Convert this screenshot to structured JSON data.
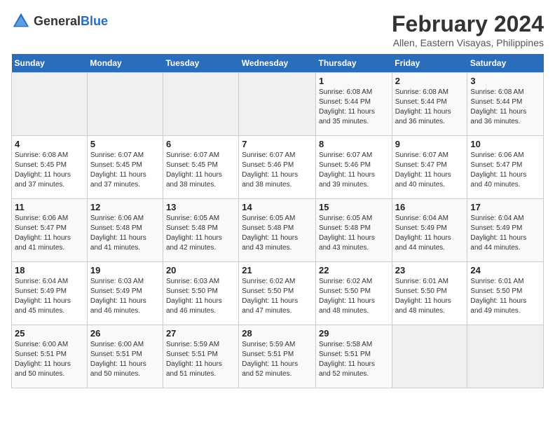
{
  "logo": {
    "text_general": "General",
    "text_blue": "Blue"
  },
  "title": "February 2024",
  "subtitle": "Allen, Eastern Visayas, Philippines",
  "days_header": [
    "Sunday",
    "Monday",
    "Tuesday",
    "Wednesday",
    "Thursday",
    "Friday",
    "Saturday"
  ],
  "weeks": [
    [
      {
        "day": "",
        "detail": ""
      },
      {
        "day": "",
        "detail": ""
      },
      {
        "day": "",
        "detail": ""
      },
      {
        "day": "",
        "detail": ""
      },
      {
        "day": "1",
        "detail": "Sunrise: 6:08 AM\nSunset: 5:44 PM\nDaylight: 11 hours\nand 35 minutes."
      },
      {
        "day": "2",
        "detail": "Sunrise: 6:08 AM\nSunset: 5:44 PM\nDaylight: 11 hours\nand 36 minutes."
      },
      {
        "day": "3",
        "detail": "Sunrise: 6:08 AM\nSunset: 5:44 PM\nDaylight: 11 hours\nand 36 minutes."
      }
    ],
    [
      {
        "day": "4",
        "detail": "Sunrise: 6:08 AM\nSunset: 5:45 PM\nDaylight: 11 hours\nand 37 minutes."
      },
      {
        "day": "5",
        "detail": "Sunrise: 6:07 AM\nSunset: 5:45 PM\nDaylight: 11 hours\nand 37 minutes."
      },
      {
        "day": "6",
        "detail": "Sunrise: 6:07 AM\nSunset: 5:45 PM\nDaylight: 11 hours\nand 38 minutes."
      },
      {
        "day": "7",
        "detail": "Sunrise: 6:07 AM\nSunset: 5:46 PM\nDaylight: 11 hours\nand 38 minutes."
      },
      {
        "day": "8",
        "detail": "Sunrise: 6:07 AM\nSunset: 5:46 PM\nDaylight: 11 hours\nand 39 minutes."
      },
      {
        "day": "9",
        "detail": "Sunrise: 6:07 AM\nSunset: 5:47 PM\nDaylight: 11 hours\nand 40 minutes."
      },
      {
        "day": "10",
        "detail": "Sunrise: 6:06 AM\nSunset: 5:47 PM\nDaylight: 11 hours\nand 40 minutes."
      }
    ],
    [
      {
        "day": "11",
        "detail": "Sunrise: 6:06 AM\nSunset: 5:47 PM\nDaylight: 11 hours\nand 41 minutes."
      },
      {
        "day": "12",
        "detail": "Sunrise: 6:06 AM\nSunset: 5:48 PM\nDaylight: 11 hours\nand 41 minutes."
      },
      {
        "day": "13",
        "detail": "Sunrise: 6:05 AM\nSunset: 5:48 PM\nDaylight: 11 hours\nand 42 minutes."
      },
      {
        "day": "14",
        "detail": "Sunrise: 6:05 AM\nSunset: 5:48 PM\nDaylight: 11 hours\nand 43 minutes."
      },
      {
        "day": "15",
        "detail": "Sunrise: 6:05 AM\nSunset: 5:48 PM\nDaylight: 11 hours\nand 43 minutes."
      },
      {
        "day": "16",
        "detail": "Sunrise: 6:04 AM\nSunset: 5:49 PM\nDaylight: 11 hours\nand 44 minutes."
      },
      {
        "day": "17",
        "detail": "Sunrise: 6:04 AM\nSunset: 5:49 PM\nDaylight: 11 hours\nand 44 minutes."
      }
    ],
    [
      {
        "day": "18",
        "detail": "Sunrise: 6:04 AM\nSunset: 5:49 PM\nDaylight: 11 hours\nand 45 minutes."
      },
      {
        "day": "19",
        "detail": "Sunrise: 6:03 AM\nSunset: 5:49 PM\nDaylight: 11 hours\nand 46 minutes."
      },
      {
        "day": "20",
        "detail": "Sunrise: 6:03 AM\nSunset: 5:50 PM\nDaylight: 11 hours\nand 46 minutes."
      },
      {
        "day": "21",
        "detail": "Sunrise: 6:02 AM\nSunset: 5:50 PM\nDaylight: 11 hours\nand 47 minutes."
      },
      {
        "day": "22",
        "detail": "Sunrise: 6:02 AM\nSunset: 5:50 PM\nDaylight: 11 hours\nand 48 minutes."
      },
      {
        "day": "23",
        "detail": "Sunrise: 6:01 AM\nSunset: 5:50 PM\nDaylight: 11 hours\nand 48 minutes."
      },
      {
        "day": "24",
        "detail": "Sunrise: 6:01 AM\nSunset: 5:50 PM\nDaylight: 11 hours\nand 49 minutes."
      }
    ],
    [
      {
        "day": "25",
        "detail": "Sunrise: 6:00 AM\nSunset: 5:51 PM\nDaylight: 11 hours\nand 50 minutes."
      },
      {
        "day": "26",
        "detail": "Sunrise: 6:00 AM\nSunset: 5:51 PM\nDaylight: 11 hours\nand 50 minutes."
      },
      {
        "day": "27",
        "detail": "Sunrise: 5:59 AM\nSunset: 5:51 PM\nDaylight: 11 hours\nand 51 minutes."
      },
      {
        "day": "28",
        "detail": "Sunrise: 5:59 AM\nSunset: 5:51 PM\nDaylight: 11 hours\nand 52 minutes."
      },
      {
        "day": "29",
        "detail": "Sunrise: 5:58 AM\nSunset: 5:51 PM\nDaylight: 11 hours\nand 52 minutes."
      },
      {
        "day": "",
        "detail": ""
      },
      {
        "day": "",
        "detail": ""
      }
    ]
  ]
}
